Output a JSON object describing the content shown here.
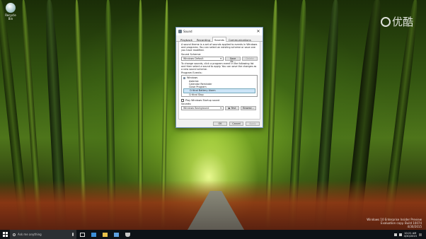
{
  "desktop": {
    "icon_label": "Recycle Bin",
    "watermark": "优酷",
    "build_info": [
      "Windows 10 Enterprise Insider Preview",
      "Evaluation copy. Build 10074",
      "4/30/2015"
    ]
  },
  "dialog": {
    "title": "Sound",
    "close": "✕",
    "tabs": [
      "Playback",
      "Recording",
      "Sounds",
      "Communications"
    ],
    "active_tab": "Sounds",
    "intro": "A sound theme is a set of sounds applied to events in Windows and programs. You can select an existing scheme or save one you have modified.",
    "scheme_label": "Sound Scheme:",
    "scheme_value": "Windows Default",
    "save_as": "Save As...",
    "delete": "Delete",
    "instructions": "To change sounds, click a program event in the following list and then select a sound to apply. You can save the changes as a new sound scheme.",
    "events_label": "Program Events:",
    "events": [
      {
        "label": "Windows",
        "child": false,
        "selected": false
      },
      {
        "label": "Asterisk",
        "child": true,
        "selected": false
      },
      {
        "label": "Calendar Reminder",
        "child": true,
        "selected": false
      },
      {
        "label": "Close Program",
        "child": true,
        "selected": false
      },
      {
        "label": "Critical Battery Alarm",
        "child": true,
        "selected": true
      },
      {
        "label": "Critical Stop",
        "child": true,
        "selected": false
      }
    ],
    "startup_check": "Play Windows Startup sound",
    "sounds_label": "Sounds:",
    "sound_value": "Windows Background",
    "test": "▶ Test",
    "browse": "Browse...",
    "ok": "OK",
    "cancel": "Cancel",
    "apply": "Apply"
  },
  "taskbar": {
    "search_placeholder": "Ask me anything",
    "clock_time": "10:21 AM",
    "clock_date": "4/30/2015"
  }
}
